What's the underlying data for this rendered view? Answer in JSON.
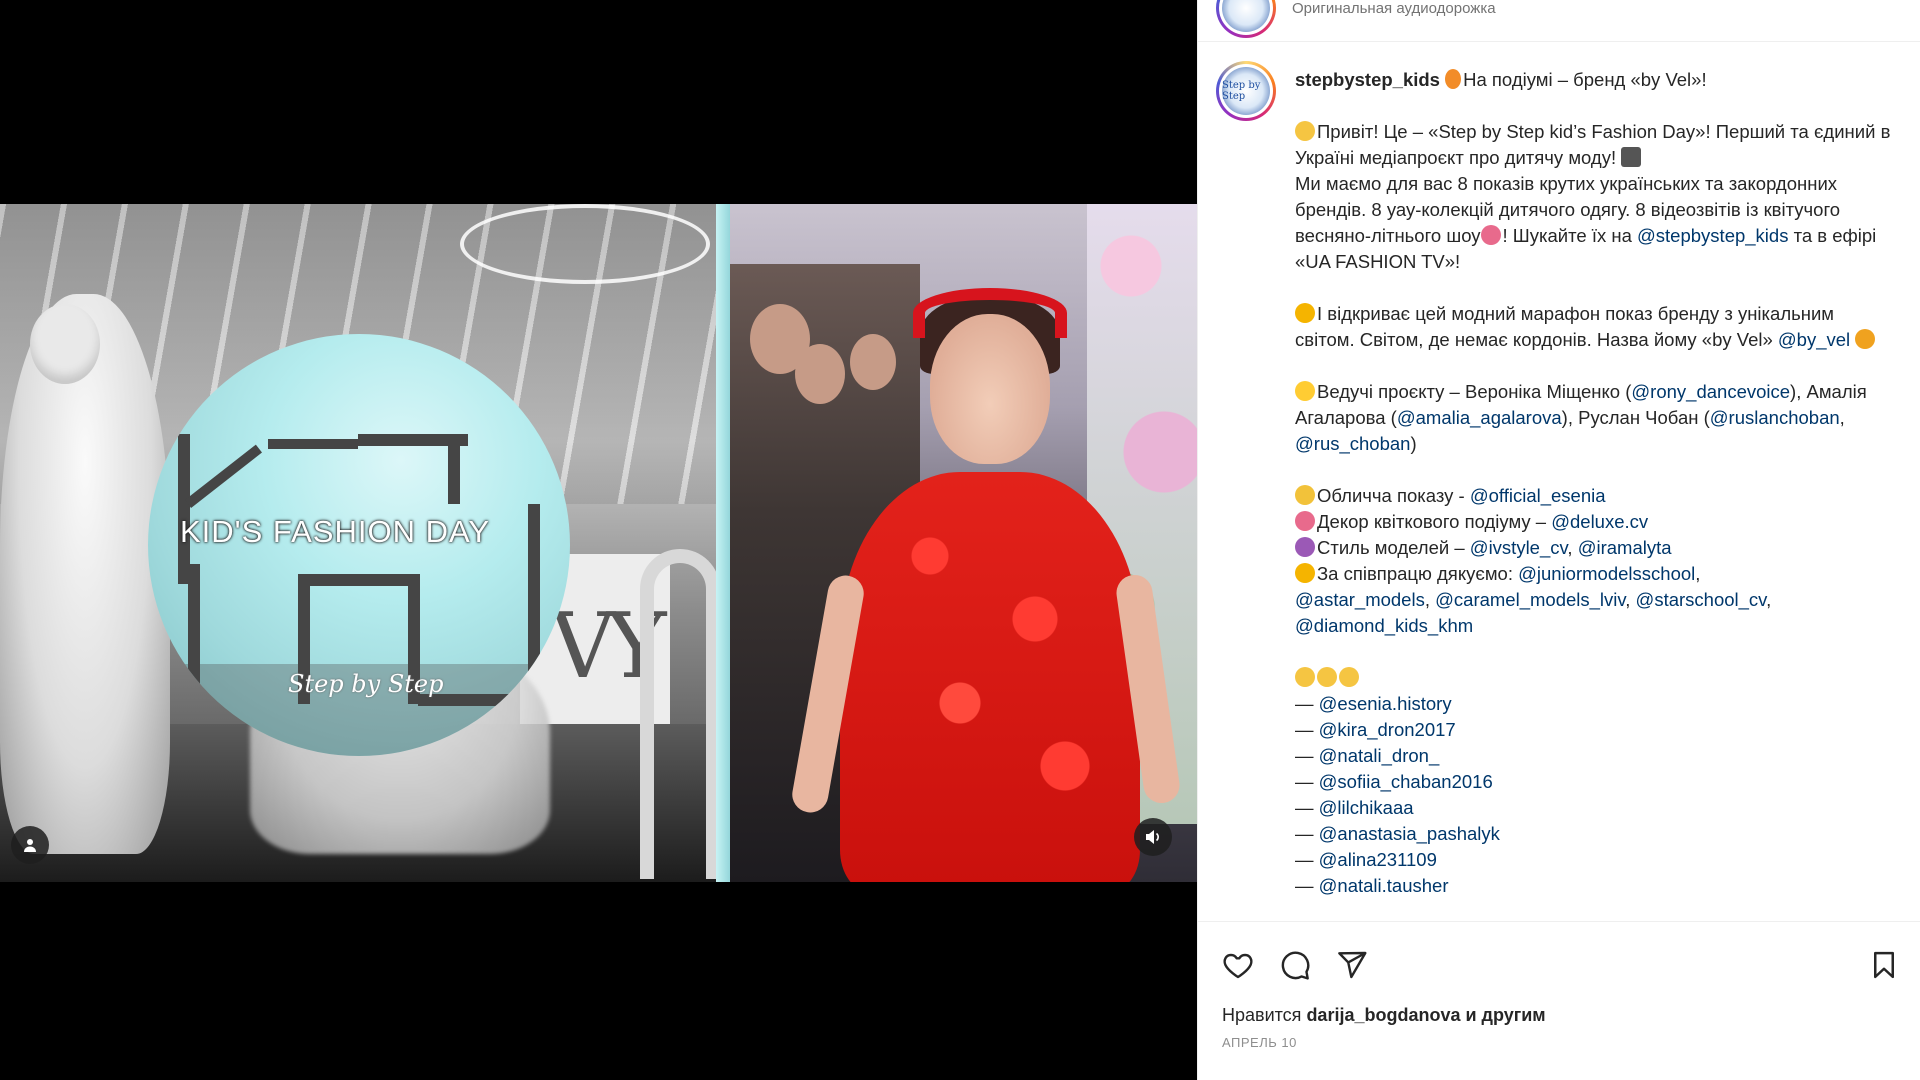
{
  "audio": {
    "label": "Оригинальная аудиодорожка"
  },
  "media": {
    "logo_title": "KID'S FASHION DAY",
    "logo_subtitle": "Step by Step",
    "wall_sign": "VY"
  },
  "post": {
    "username": "stepbystep_kids",
    "lines": [
      {
        "t": "На подіумі – бренд «by Vel»!"
      },
      {
        "t": "Привіт! Це – «Step by Step kid’s Fashion Day»! Перший та єдиний в Україні медіапроєкт про дитячу моду! "
      },
      {
        "t": "Ми маємо для вас 8 показів крутих українських та закордонних брендів. 8 уау-колекцій дитячого одягу. 8 відеозвітів із квітучого весняно-літнього шоу"
      },
      {
        "t": "! Шукайте їх на "
      },
      {
        "t": "@stepbystep_kids"
      },
      {
        "t": " та в ефірі «UA FASHION TV»!"
      },
      {
        "t": "І відкриває цей модний марафон показ бренду з унікальним світом. Світом, де немає кордонів. Назва йому «by Vel» "
      },
      {
        "t": "@by_vel"
      },
      {
        "t": "Ведучі проєкту – Вероніка Міщенко ("
      },
      {
        "t": "@rony_dancevoice"
      },
      {
        "t": "), Амалія Агаларова ("
      },
      {
        "t": "@amalia_agalarova"
      },
      {
        "t": "), Руслан Чобан ("
      },
      {
        "t": "@ruslanchoban"
      },
      {
        "t": ", "
      },
      {
        "t": "@rus_choban"
      },
      {
        "t": ")"
      },
      {
        "t": "Обличча показу - "
      },
      {
        "t": "@official_esenia"
      },
      {
        "t": "Декор квіткового подіуму – "
      },
      {
        "t": "@deluxe.cv"
      },
      {
        "t": "Стиль моделей – "
      },
      {
        "t": "@ivstyle_cv"
      },
      {
        "t": ", "
      },
      {
        "t": "@iramalyta"
      },
      {
        "t": "За співпрацю дякуємо: "
      },
      {
        "t": "@juniormodelsschool"
      },
      {
        "t": ","
      },
      {
        "t": "@astar_models"
      },
      {
        "t": "@caramel_models_lviv"
      },
      {
        "t": "@starschool_cv"
      },
      {
        "t": "@diamond_kids_khm"
      },
      {
        "t": "— "
      },
      {
        "t": "@esenia.history"
      },
      {
        "t": "@kira_dron2017"
      },
      {
        "t": "@natali_dron_"
      },
      {
        "t": "@sofiia_chaban2016"
      },
      {
        "t": "@lilchikaaa"
      },
      {
        "t": "@anastasia_pashalyk"
      },
      {
        "t": "@alina231109"
      },
      {
        "t": "@natali.tausher"
      }
    ]
  },
  "footer": {
    "likes_prefix": "Нравится ",
    "likes_user": "darija_bogdanova",
    "likes_suffix": " и другим",
    "date": "АПРЕЛЬ 10"
  },
  "colors": {
    "mention": "#00376b",
    "text": "#262626",
    "muted": "#737373",
    "dress": "#e3221b",
    "logo_teal": "#b5ecee"
  },
  "icons": [
    "user-tag-icon",
    "volume-icon",
    "heart-icon",
    "comment-icon",
    "share-icon",
    "bookmark-icon"
  ]
}
